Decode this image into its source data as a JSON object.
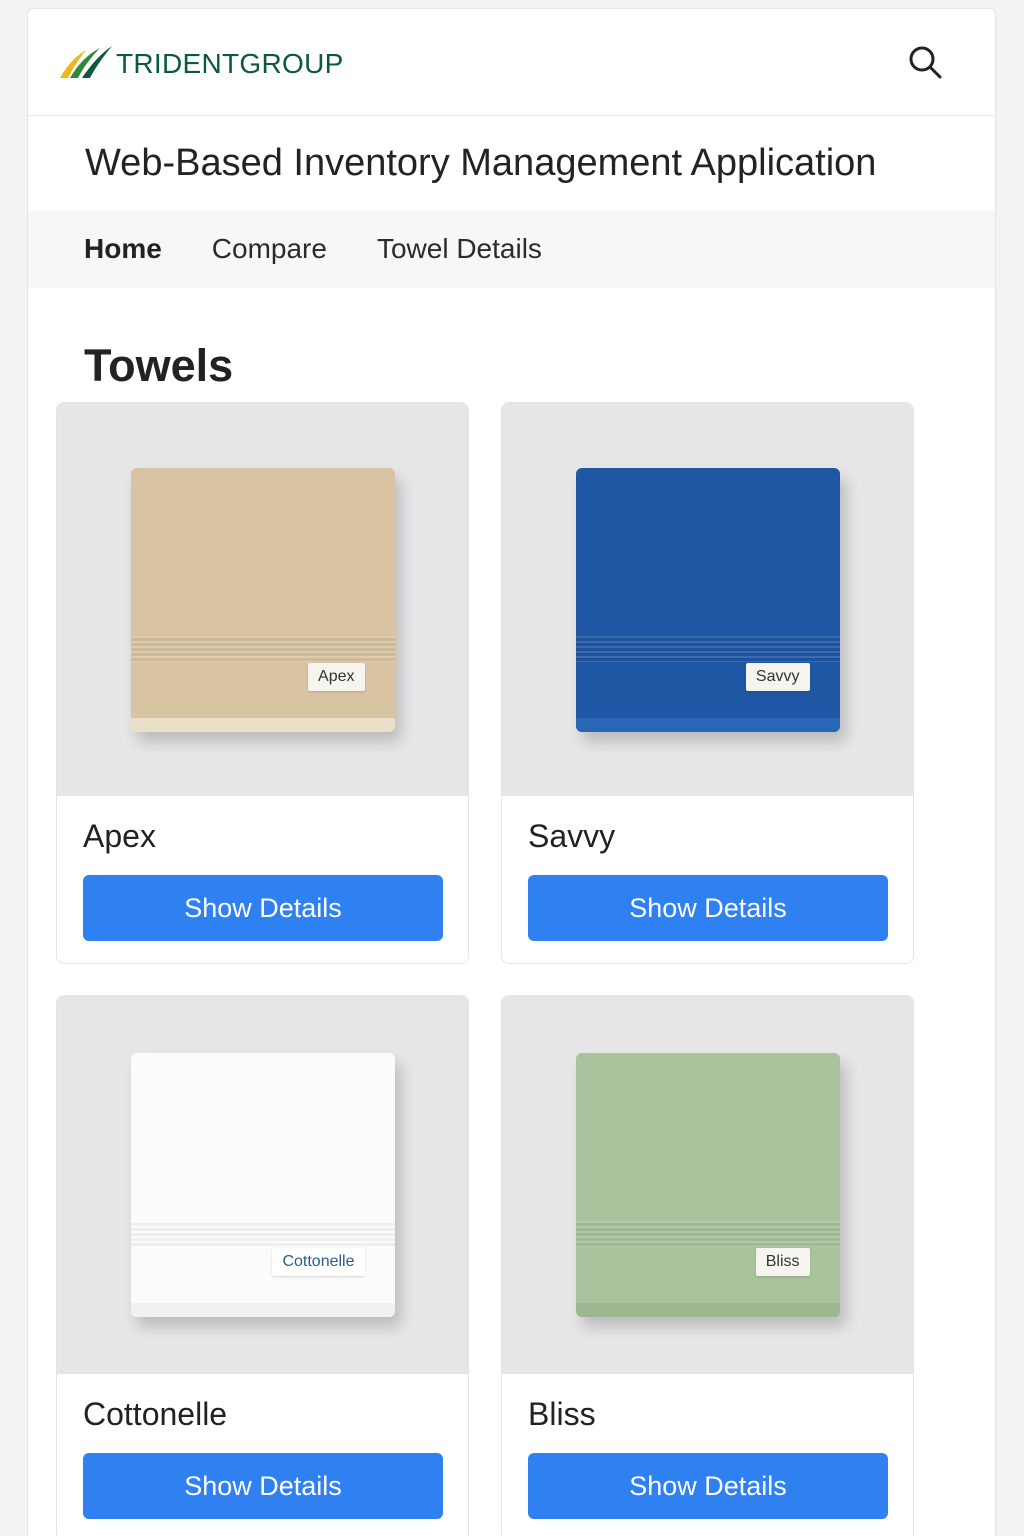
{
  "brand": {
    "name": "TRIDENTGROUP",
    "color": "#0d5a3a",
    "accent_colors": [
      "#f0b41c",
      "#2d8a3c",
      "#0d5a3a"
    ]
  },
  "header": {
    "search_icon": "search-icon"
  },
  "app": {
    "title": "Web-Based Inventory Management Application"
  },
  "nav": {
    "items": [
      {
        "label": "Home",
        "active": true
      },
      {
        "label": "Compare",
        "active": false
      },
      {
        "label": "Towel Details",
        "active": false
      }
    ]
  },
  "section": {
    "title": "Towels"
  },
  "towels": [
    {
      "name": "Apex",
      "tag": "Apex",
      "button": "Show Details",
      "color": "#d8c4a3",
      "hem": "#eadfc9"
    },
    {
      "name": "Savvy",
      "tag": "Savvy",
      "button": "Show Details",
      "color": "#1f57a4",
      "hem": "#2a66b8"
    },
    {
      "name": "Cottonelle",
      "tag": "Cottonelle",
      "button": "Show Details",
      "color": "#fbfbfb",
      "hem": "#f1f1f1"
    },
    {
      "name": "Bliss",
      "tag": "Bliss",
      "button": "Show Details",
      "color": "#a9c39d",
      "hem": "#9db791"
    }
  ],
  "theme": {
    "button_color": "#2f80f1"
  }
}
